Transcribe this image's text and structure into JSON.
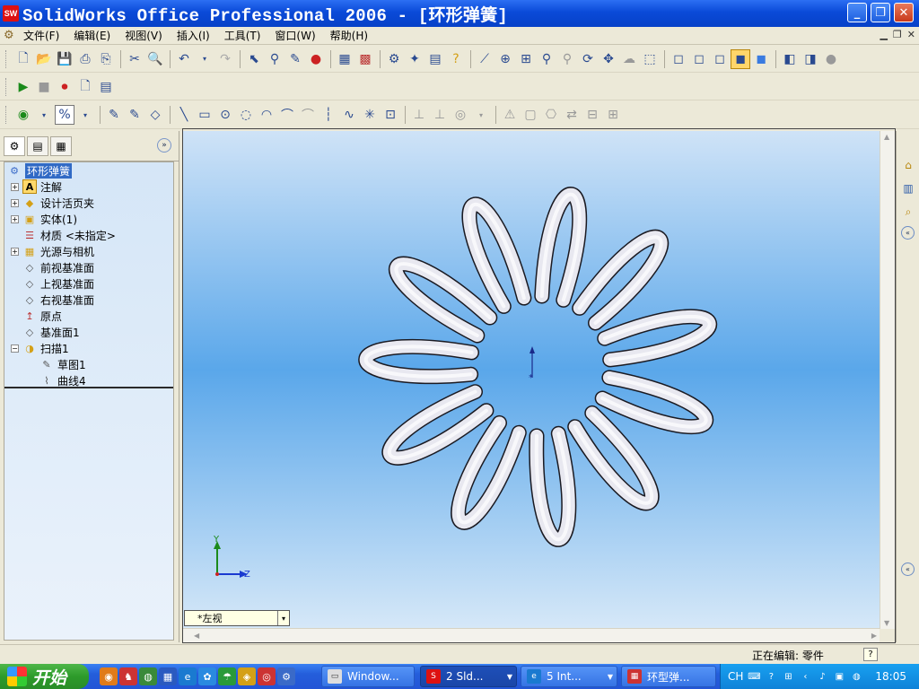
{
  "window": {
    "app_icon_text": "SW",
    "title": "SolidWorks Office Professional 2006 - [环形弹簧]"
  },
  "menu": {
    "items": [
      {
        "label": "文件(F)"
      },
      {
        "label": "编辑(E)"
      },
      {
        "label": "视图(V)"
      },
      {
        "label": "插入(I)"
      },
      {
        "label": "工具(T)"
      },
      {
        "label": "窗口(W)"
      },
      {
        "label": "帮助(H)"
      }
    ]
  },
  "feature_tree": {
    "root": "环形弹簧",
    "items": [
      {
        "label": "注解",
        "icon": "annotations-icon",
        "expandable": true
      },
      {
        "label": "设计活页夹",
        "icon": "design-binder-icon",
        "expandable": true
      },
      {
        "label": "实体(1)",
        "icon": "solid-bodies-icon",
        "expandable": true
      },
      {
        "label": "材质 <未指定>",
        "icon": "material-icon",
        "expandable": false
      },
      {
        "label": "光源与相机",
        "icon": "lights-cameras-icon",
        "expandable": true
      },
      {
        "label": "前视基准面",
        "icon": "plane-icon",
        "expandable": false
      },
      {
        "label": "上视基准面",
        "icon": "plane-icon",
        "expandable": false
      },
      {
        "label": "右视基准面",
        "icon": "plane-icon",
        "expandable": false
      },
      {
        "label": "原点",
        "icon": "origin-icon",
        "expandable": false
      },
      {
        "label": "基准面1",
        "icon": "plane-icon",
        "expandable": false
      },
      {
        "label": "扫描1",
        "icon": "sweep-icon",
        "expandable": true,
        "expanded": true
      },
      {
        "label": "草图1",
        "icon": "sketch-icon",
        "child": true
      },
      {
        "label": "曲线4",
        "icon": "curve-icon",
        "child": true
      }
    ]
  },
  "viewport": {
    "view_name": "*左视",
    "triad_y": "Y",
    "triad_z": "Z",
    "petal_count": 11
  },
  "status": {
    "text": "正在编辑: 零件",
    "help": "?"
  },
  "taskbar": {
    "start_label": "开始",
    "buttons": [
      {
        "label": "Window...",
        "icon": "explorer-window-icon",
        "active": false
      },
      {
        "label": "2 Sld...",
        "icon": "solidworks-icon",
        "active": true
      },
      {
        "label": "5 Int...",
        "icon": "internet-explorer-icon",
        "active": false
      },
      {
        "label": "环型弹...",
        "icon": "image-viewer-icon",
        "active": false
      }
    ],
    "tray_lang": "CH",
    "clock": "18:05"
  },
  "colors": {
    "titlebar": "#0a4ad8",
    "viewport_top": "#cfe3f7",
    "viewport_mid": "#5aa7ea",
    "spring": "#e8e8f0",
    "spring_edge": "#1a1a22",
    "taskbar": "#245edb",
    "start": "#2d9b2a"
  }
}
